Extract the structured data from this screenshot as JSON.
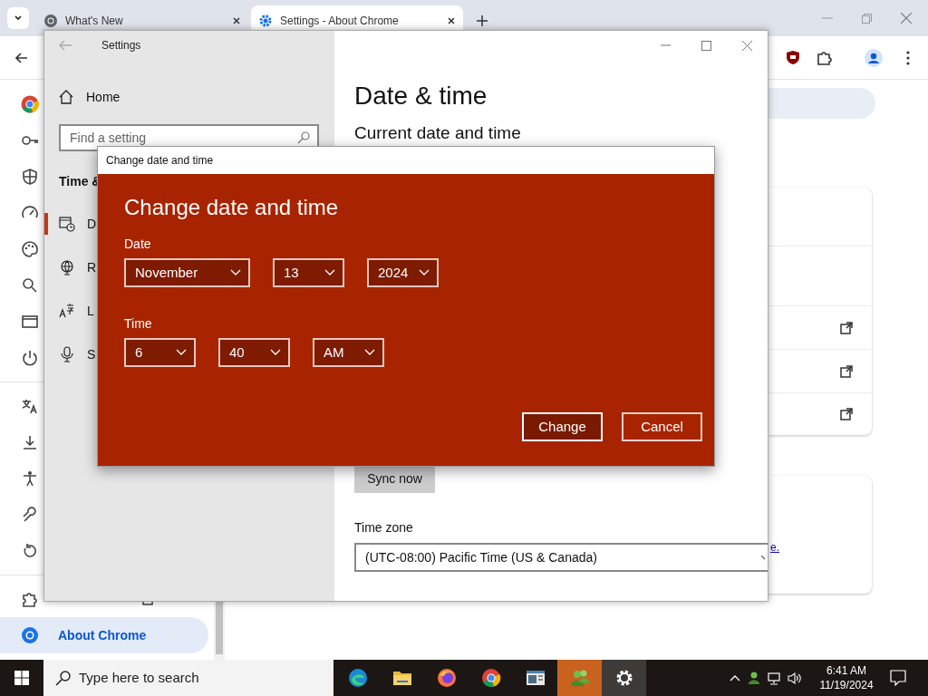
{
  "browser": {
    "tabs": [
      {
        "title": "What's New",
        "selected": false
      },
      {
        "title": "Settings - About Chrome",
        "selected": true
      }
    ]
  },
  "chrome_nav": {
    "items": [
      {
        "selected": false
      },
      {
        "label": "About Chrome",
        "selected": true
      }
    ]
  },
  "chrome_content": {
    "link": "e."
  },
  "settings_window": {
    "title": "Settings",
    "home": "Home",
    "search": {
      "placeholder": "Find a setting"
    },
    "section": "Time &",
    "nav": [
      {
        "label": "D",
        "selected": true
      },
      {
        "label": "R",
        "selected": false
      },
      {
        "label": "L",
        "selected": false
      },
      {
        "label": "S",
        "selected": false
      }
    ],
    "heading": "Date & time",
    "subheading": "Current date and time",
    "sync_button": "Sync now",
    "time_zone": {
      "label": "Time zone",
      "value": "(UTC-08:00) Pacific Time (US & Canada)"
    }
  },
  "dialog": {
    "title": "Change date and time",
    "heading": "Change date and time",
    "groups": [
      {
        "label": "Date",
        "fields": [
          "November",
          "13",
          "2024"
        ]
      },
      {
        "label": "Time",
        "fields": [
          "6",
          "40",
          "AM"
        ]
      }
    ],
    "buttons": [
      {
        "label": "Change",
        "kind": "primary"
      },
      {
        "label": "Cancel",
        "kind": "secondary"
      }
    ]
  },
  "taskbar": {
    "search": {
      "placeholder": "Type here to search"
    },
    "apps": [
      {
        "selected": false,
        "flashing": false
      },
      {
        "selected": false,
        "flashing": false
      },
      {
        "selected": false,
        "flashing": false
      },
      {
        "selected": false,
        "flashing": false
      },
      {
        "selected": false,
        "flashing": false
      },
      {
        "selected": false,
        "flashing": true
      },
      {
        "selected": true,
        "flashing": false
      }
    ],
    "time": "6:41 AM",
    "date": "11/19/2024"
  }
}
